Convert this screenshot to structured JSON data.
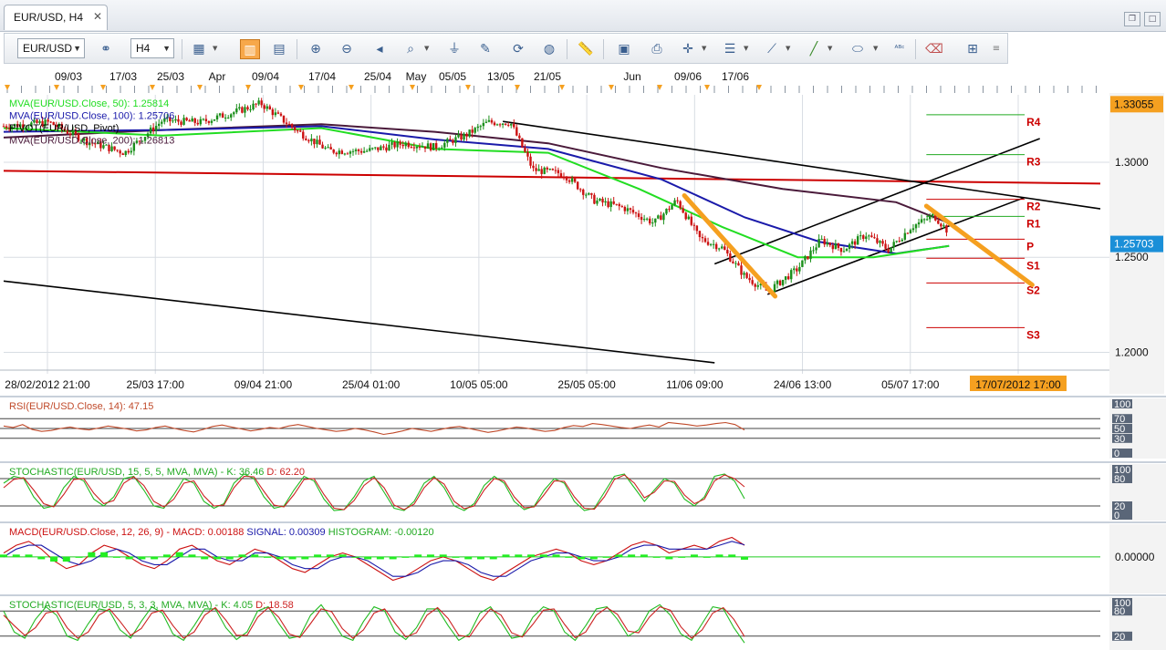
{
  "tab": {
    "title": "EUR/USD, H4",
    "close_glyph": "✕"
  },
  "toolbar": {
    "symbol": "EUR/USD",
    "timeframe": "H4"
  },
  "colors": {
    "up": "#1a8f1a",
    "down": "#cc1111",
    "ma50": "#22dd22",
    "ma100": "#1a1aaa",
    "ma200": "#4a1a3a",
    "pivot": "#cc0000",
    "trend": "#000000",
    "arrow": "#f5a020",
    "price_bg": "#1a8fd8",
    "highlight_bg": "#f5a020"
  },
  "chart_data": [
    {
      "type": "candlestick",
      "title": "",
      "top_time_labels": [
        "09/03",
        "17/03",
        "25/03",
        "Apr",
        "09/04",
        "17/04",
        "25/04",
        "May",
        "05/05",
        "13/05",
        "21/05",
        "Jun",
        "09/06",
        "17/06"
      ],
      "time_axis_labels": [
        "28/02/2012 21:00",
        "25/03 17:00",
        "09/04 21:00",
        "25/04 01:00",
        "10/05 05:00",
        "25/05 05:00",
        "11/06 09:00",
        "24/06 13:00",
        "05/07 17:00",
        "17/07/2012 17:00"
      ],
      "y_ticks": [
        1.2,
        1.25,
        1.3
      ],
      "y_tick_labels": [
        "1.2000",
        "1.2500",
        "1.3000"
      ],
      "ylim": [
        1.1935,
        1.3355
      ],
      "top_price": "1.33055",
      "last_price": "1.25703",
      "x_range": [
        "2012-02-28",
        "2012-07-22"
      ],
      "price_path": [
        [
          "2012-02-28",
          1.319
        ],
        [
          "2012-03-05",
          1.321
        ],
        [
          "2012-03-10",
          1.311
        ],
        [
          "2012-03-15",
          1.305
        ],
        [
          "2012-03-20",
          1.322
        ],
        [
          "2012-03-25",
          1.321
        ],
        [
          "2012-03-30",
          1.327
        ],
        [
          "2012-04-02",
          1.331
        ],
        [
          "2012-04-07",
          1.316
        ],
        [
          "2012-04-11",
          1.306
        ],
        [
          "2012-04-16",
          1.306
        ],
        [
          "2012-04-21",
          1.31
        ],
        [
          "2012-04-25",
          1.308
        ],
        [
          "2012-04-29",
          1.314
        ],
        [
          "2012-05-02",
          1.321
        ],
        [
          "2012-05-05",
          1.321
        ],
        [
          "2012-05-08",
          1.296
        ],
        [
          "2012-05-12",
          1.294
        ],
        [
          "2012-05-16",
          1.28
        ],
        [
          "2012-05-20",
          1.276
        ],
        [
          "2012-05-24",
          1.268
        ],
        [
          "2012-05-27",
          1.28
        ],
        [
          "2012-05-30",
          1.26
        ],
        [
          "2012-06-02",
          1.255
        ],
        [
          "2012-06-05",
          1.24
        ],
        [
          "2012-06-08",
          1.232
        ],
        [
          "2012-06-12",
          1.244
        ],
        [
          "2012-06-15",
          1.259
        ],
        [
          "2012-06-18",
          1.254
        ],
        [
          "2012-06-21",
          1.262
        ],
        [
          "2012-06-24",
          1.254
        ],
        [
          "2012-06-27",
          1.266
        ],
        [
          "2012-06-30",
          1.272
        ],
        [
          "2012-07-02",
          1.263
        ]
      ],
      "ma50": [
        [
          "2012-02-28",
          1.318
        ],
        [
          "2012-03-20",
          1.314
        ],
        [
          "2012-04-10",
          1.318
        ],
        [
          "2012-04-25",
          1.307
        ],
        [
          "2012-05-10",
          1.305
        ],
        [
          "2012-05-22",
          1.286
        ],
        [
          "2012-06-02",
          1.266
        ],
        [
          "2012-06-12",
          1.25
        ],
        [
          "2012-06-22",
          1.25
        ],
        [
          "2012-07-02",
          1.256
        ]
      ],
      "ma100": [
        [
          "2012-02-28",
          1.316
        ],
        [
          "2012-03-20",
          1.317
        ],
        [
          "2012-04-10",
          1.319
        ],
        [
          "2012-04-25",
          1.312
        ],
        [
          "2012-05-10",
          1.307
        ],
        [
          "2012-05-25",
          1.291
        ],
        [
          "2012-06-05",
          1.271
        ],
        [
          "2012-06-15",
          1.258
        ],
        [
          "2012-06-25",
          1.252
        ],
        [
          "2012-07-02",
          1.256
        ]
      ],
      "ma200": [
        [
          "2012-02-28",
          1.313
        ],
        [
          "2012-03-20",
          1.317
        ],
        [
          "2012-04-10",
          1.32
        ],
        [
          "2012-04-25",
          1.316
        ],
        [
          "2012-05-10",
          1.31
        ],
        [
          "2012-05-25",
          1.297
        ],
        [
          "2012-06-10",
          1.286
        ],
        [
          "2012-06-25",
          1.279
        ],
        [
          "2012-07-02",
          1.268
        ]
      ],
      "trendlines": [
        {
          "from": [
            "2012-02-28",
            1.2955
          ],
          "to": [
            "2012-07-22",
            1.2888
          ],
          "color": "pivot"
        },
        {
          "from": [
            "2012-05-04",
            1.3215
          ],
          "to": [
            "2012-07-22",
            1.2755
          ],
          "color": "trend"
        },
        {
          "from": [
            "2012-02-28",
            1.2375
          ],
          "to": [
            "2012-06-01",
            1.1945
          ],
          "color": "trend"
        },
        {
          "from": [
            "2012-06-08",
            1.2305
          ],
          "to": [
            "2012-07-12",
            1.2815
          ],
          "color": "trend"
        },
        {
          "from": [
            "2012-06-01",
            1.2465
          ],
          "to": [
            "2012-07-14",
            1.3125
          ],
          "color": "trend"
        }
      ],
      "arrows": [
        {
          "from": [
            "2012-05-28",
            1.2825
          ],
          "to": [
            "2012-06-09",
            1.2295
          ]
        },
        {
          "from": [
            "2012-06-29",
            1.277
          ],
          "to": [
            "2012-07-13",
            1.2355
          ]
        }
      ],
      "pivot_levels": [
        {
          "label": "R4",
          "value": 1.325
        },
        {
          "label": "R3",
          "value": 1.304
        },
        {
          "label": "R2",
          "value": 1.2805
        },
        {
          "label": "R1",
          "value": 1.2715
        },
        {
          "label": "P",
          "value": 1.2595
        },
        {
          "label": "S1",
          "value": 1.2495
        },
        {
          "label": "S2",
          "value": 1.2365
        },
        {
          "label": "S3",
          "value": 1.213
        }
      ],
      "pivot_range": [
        "2012-06-29",
        "2012-07-12"
      ],
      "indicator_labels": [
        {
          "text": "MVA(EUR/USD.Close, 50): 1.25814",
          "color": "ma50"
        },
        {
          "text": "MVA(EUR/USD.Close, 100): 1.25706",
          "color": "ma100"
        },
        {
          "text": "PIVOT(EUR/USD, Pivot)",
          "color": "trend"
        },
        {
          "text": "MVA(EUR/USD.Close, 200): 1.26813",
          "color": "ma200"
        }
      ]
    },
    {
      "type": "line",
      "name_label": "RSI(EUR/USD.Close, 14): 47.15",
      "ylim": [
        0,
        100
      ],
      "levels": [
        30,
        50,
        70
      ],
      "tick_labels": [
        "100",
        "70",
        "50",
        "30",
        "0"
      ],
      "series": [
        {
          "values": [
            55,
            52,
            58,
            48,
            44,
            46,
            50,
            53,
            49,
            47,
            51,
            55,
            52,
            49,
            45,
            47,
            52,
            55,
            50,
            46,
            43,
            48,
            54,
            57,
            53,
            49,
            45,
            48,
            52,
            50,
            55,
            58,
            54,
            50,
            47,
            44,
            46,
            50,
            47,
            43,
            38,
            41,
            45,
            50,
            47,
            44,
            48,
            52,
            54,
            50,
            46,
            42,
            45,
            49,
            53,
            51,
            47,
            44,
            46,
            52,
            56,
            54,
            60,
            58,
            55,
            52,
            50,
            54,
            57,
            53,
            62,
            60,
            58,
            55,
            57,
            60,
            62,
            58,
            47
          ]
        }
      ]
    },
    {
      "type": "line",
      "name_label": "STOCHASTIC(EUR/USD, 15, 5, 5, MVA, MVA) -  K: 36.46   D: 62.20",
      "ylim": [
        0,
        100
      ],
      "levels": [
        20,
        80
      ],
      "tick_labels": [
        "100",
        "80",
        "20",
        "0"
      ],
      "series": [
        {
          "name": "K",
          "values": [
            70,
            85,
            80,
            40,
            15,
            20,
            60,
            85,
            75,
            35,
            20,
            40,
            80,
            85,
            55,
            20,
            15,
            45,
            80,
            70,
            30,
            15,
            25,
            70,
            90,
            80,
            40,
            15,
            20,
            55,
            85,
            75,
            35,
            10,
            12,
            40,
            75,
            85,
            50,
            15,
            10,
            30,
            70,
            85,
            60,
            20,
            10,
            25,
            65,
            85,
            70,
            30,
            12,
            20,
            55,
            80,
            70,
            30,
            10,
            15,
            50,
            85,
            90,
            60,
            30,
            55,
            80,
            70,
            35,
            20,
            40,
            85,
            90,
            75,
            36
          ]
        },
        {
          "name": "D",
          "values": [
            60,
            78,
            82,
            55,
            25,
            18,
            45,
            78,
            80,
            48,
            25,
            32,
            70,
            84,
            65,
            30,
            18,
            35,
            70,
            75,
            42,
            20,
            22,
            60,
            85,
            84,
            52,
            22,
            18,
            45,
            78,
            80,
            45,
            15,
            12,
            32,
            65,
            82,
            60,
            22,
            12,
            24,
            60,
            82,
            68,
            30,
            14,
            20,
            55,
            80,
            75,
            40,
            16,
            18,
            45,
            75,
            74,
            40,
            15,
            13,
            40,
            78,
            88,
            70,
            38,
            50,
            75,
            74,
            44,
            25,
            35,
            75,
            88,
            80,
            62
          ]
        }
      ]
    },
    {
      "type": "line",
      "name_label": "MACD(EUR/USD.Close, 12, 26, 9) -  MACD: 0.00188   SIGNAL: 0.00309   HISTOGRAM: -0.00120",
      "ylim": [
        -0.008,
        0.007
      ],
      "zero_label": "0.00000",
      "series": [
        {
          "name": "MACD",
          "values": [
            1,
            3,
            4,
            2,
            -1,
            -3,
            -2,
            1,
            3,
            2,
            0,
            -2,
            -3,
            -1,
            2,
            3,
            1,
            -1,
            -2,
            0,
            2,
            1,
            -1,
            -3,
            -4,
            -2,
            0,
            1,
            0,
            -2,
            -4,
            -6,
            -5,
            -3,
            -1,
            0,
            -1,
            -3,
            -5,
            -6,
            -4,
            -2,
            0,
            1,
            2,
            1,
            -1,
            -2,
            -1,
            1,
            3,
            4,
            3,
            1,
            2,
            3,
            2,
            4,
            5,
            3
          ]
        },
        {
          "name": "SIGNAL",
          "values": [
            0,
            2,
            3,
            3,
            1,
            -1,
            -2,
            -1,
            1,
            2,
            1,
            -1,
            -2,
            -2,
            0,
            2,
            2,
            0,
            -1,
            -1,
            1,
            1,
            0,
            -2,
            -3,
            -3,
            -1,
            0,
            0,
            -1,
            -3,
            -5,
            -5,
            -4,
            -2,
            -1,
            -1,
            -2,
            -4,
            -5,
            -5,
            -3,
            -1,
            0,
            1,
            1,
            0,
            -1,
            -1,
            0,
            2,
            3,
            3,
            2,
            2,
            2,
            2,
            3,
            4,
            3.1
          ]
        },
        {
          "name": "HISTOGRAM",
          "values": [
            1,
            1,
            1,
            -1,
            -2,
            -2,
            0,
            2,
            2,
            0,
            -1,
            -1,
            -1,
            1,
            2,
            1,
            -1,
            -1,
            -1,
            1,
            1,
            0,
            -1,
            -1,
            -1,
            1,
            1,
            1,
            0,
            -1,
            -1,
            -1,
            0,
            1,
            1,
            1,
            0,
            -1,
            -1,
            -1,
            1,
            1,
            1,
            1,
            1,
            0,
            -1,
            -1,
            0,
            1,
            1,
            1,
            0,
            -1,
            0,
            1,
            0,
            1,
            1,
            -1.2
          ]
        }
      ]
    },
    {
      "type": "line",
      "name_label": "STOCHASTIC(EUR/USD, 5, 3, 3, MVA, MVA) -  K: 4.05   D: 18.58",
      "ylim": [
        0,
        100
      ],
      "levels": [
        20,
        80
      ],
      "tick_labels": [
        "100",
        "80",
        "20"
      ],
      "series": [
        {
          "name": "K",
          "values": [
            80,
            30,
            15,
            60,
            90,
            70,
            20,
            10,
            50,
            85,
            80,
            35,
            15,
            55,
            90,
            75,
            25,
            10,
            45,
            85,
            85,
            40,
            12,
            30,
            80,
            90,
            50,
            15,
            20,
            70,
            95,
            60,
            20,
            10,
            55,
            90,
            80,
            30,
            12,
            40,
            85,
            85,
            45,
            10,
            25,
            75,
            90,
            55,
            15,
            20,
            65,
            90,
            80,
            30,
            10,
            45,
            85,
            90,
            60,
            20,
            35,
            80,
            95,
            70,
            25,
            10,
            50,
            90,
            85,
            40,
            4
          ]
        },
        {
          "name": "D",
          "values": [
            70,
            45,
            22,
            40,
            75,
            80,
            40,
            15,
            30,
            70,
            85,
            55,
            22,
            38,
            75,
            82,
            45,
            15,
            30,
            70,
            88,
            58,
            22,
            22,
            65,
            88,
            65,
            25,
            17,
            50,
            85,
            78,
            38,
            15,
            35,
            75,
            85,
            50,
            18,
            28,
            70,
            88,
            62,
            22,
            18,
            55,
            85,
            70,
            28,
            18,
            48,
            82,
            85,
            48,
            16,
            30,
            70,
            88,
            72,
            32,
            28,
            65,
            90,
            82,
            42,
            15,
            35,
            75,
            88,
            60,
            19
          ]
        }
      ]
    }
  ]
}
